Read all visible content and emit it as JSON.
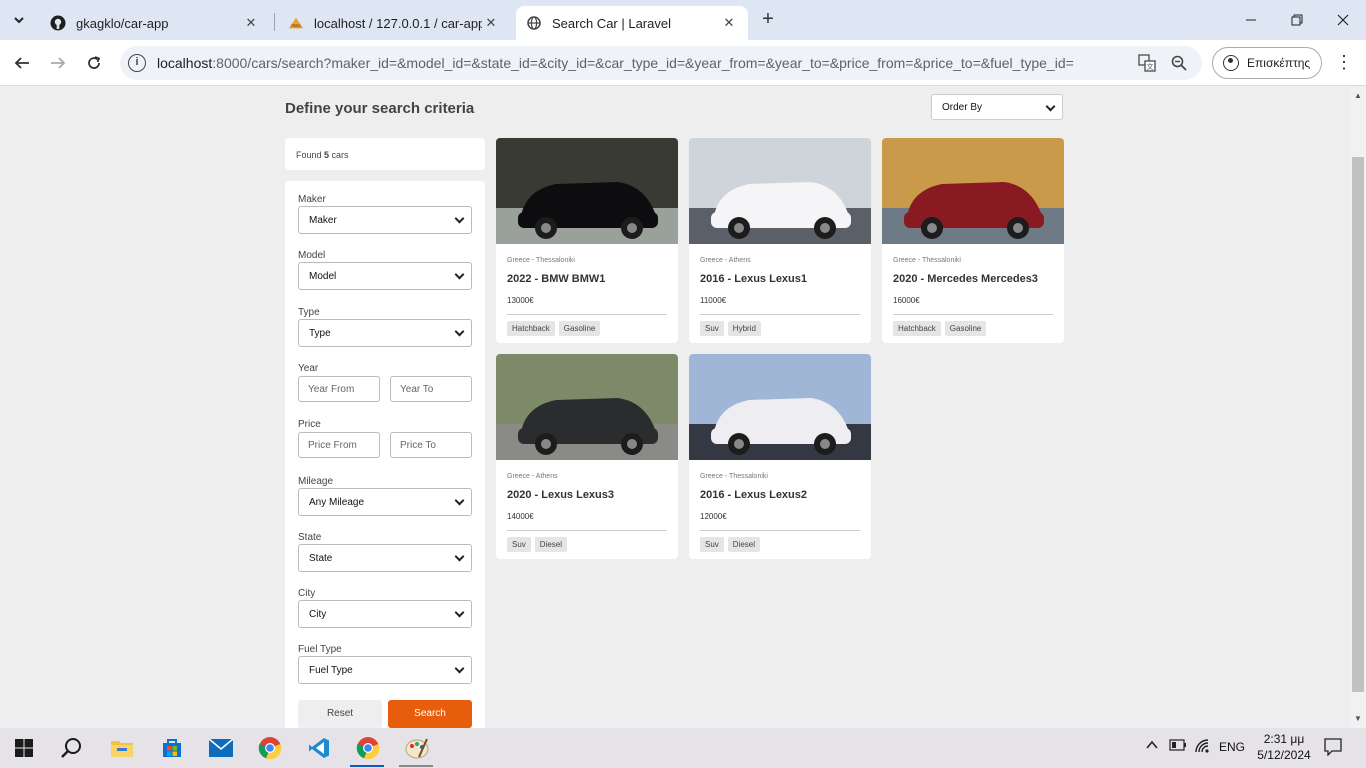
{
  "browser": {
    "tabs": [
      {
        "title": "gkagklo/car-app"
      },
      {
        "title": "localhost / 127.0.0.1 / car-app |"
      },
      {
        "title": "Search Car | Laravel"
      }
    ],
    "url_host": "localhost",
    "url_rest": ":8000/cars/search?maker_id=&model_id=&state_id=&city_id=&car_type_id=&year_from=&year_to=&price_from=&price_to=&fuel_type_id=",
    "profile_label": "Επισκέπτης"
  },
  "page": {
    "heading": "Define your search criteria",
    "order_by": "Order By",
    "found_prefix": "Found ",
    "found_count": "5",
    "found_suffix": " cars"
  },
  "filters": {
    "maker_label": "Maker",
    "maker_value": "Maker",
    "model_label": "Model",
    "model_value": "Model",
    "type_label": "Type",
    "type_value": "Type",
    "year_label": "Year",
    "year_from": "Year From",
    "year_to": "Year To",
    "price_label": "Price",
    "price_from": "Price From",
    "price_to": "Price To",
    "mileage_label": "Mileage",
    "mileage_value": "Any Mileage",
    "state_label": "State",
    "state_value": "State",
    "city_label": "City",
    "city_value": "City",
    "fuel_label": "Fuel Type",
    "fuel_value": "Fuel Type",
    "reset_label": "Reset",
    "search_label": "Search"
  },
  "cars": [
    {
      "location": "Greece - Thessaloniki",
      "title": "2022 - BMW BMW1",
      "price": "13000€",
      "tags": [
        "Hatchback",
        "Gasoline"
      ],
      "colors": [
        "#3a3a35",
        "#0d0d10",
        "#9aa09a"
      ]
    },
    {
      "location": "Greece - Athens",
      "title": "2016 - Lexus Lexus1",
      "price": "11000€",
      "tags": [
        "Suv",
        "Hybrid"
      ],
      "colors": [
        "#cfd3da",
        "#f5f5f7",
        "#5a5f68"
      ]
    },
    {
      "location": "Greece - Thessaloniki",
      "title": "2020 - Mercedes Mercedes3",
      "price": "16000€",
      "tags": [
        "Hatchback",
        "Gasoline"
      ],
      "colors": [
        "#c89a4a",
        "#8a1a22",
        "#6e7a86"
      ]
    },
    {
      "location": "Greece - Athens",
      "title": "2020 - Lexus Lexus3",
      "price": "14000€",
      "tags": [
        "Suv",
        "Diesel"
      ],
      "colors": [
        "#7d8a6a",
        "#2a2c2e",
        "#8a8a86"
      ]
    },
    {
      "location": "Greece - Thessaloniki",
      "title": "2016 - Lexus Lexus2",
      "price": "12000€",
      "tags": [
        "Suv",
        "Diesel"
      ],
      "colors": [
        "#9fb6d6",
        "#eeeef2",
        "#333842"
      ]
    }
  ],
  "taskbar": {
    "language": "ENG",
    "time": "2:31 μμ",
    "date": "5/12/2024"
  }
}
